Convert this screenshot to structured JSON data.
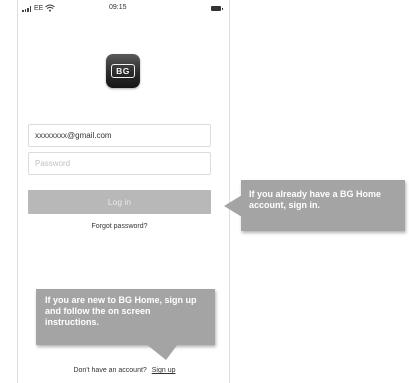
{
  "status_bar": {
    "carrier": "EE",
    "time": "09:15"
  },
  "logo": {
    "text": "BG"
  },
  "login_form": {
    "email_value": "xxxxxxxx@gmail.com",
    "password_placeholder": "Password",
    "login_label": "Log in",
    "forgot_password": "Forgot password?"
  },
  "signup": {
    "prompt": "Don't have an account?",
    "link_label": "Sign up"
  },
  "callouts": {
    "existing_user": "If you already have a BG Home account, sign in.",
    "new_user": "If you are new to BG Home, sign up and follow the on screen instructions."
  },
  "colors": {
    "callout_bg": "#a4a4a4",
    "login_button_bg": "#b8b8b8"
  }
}
